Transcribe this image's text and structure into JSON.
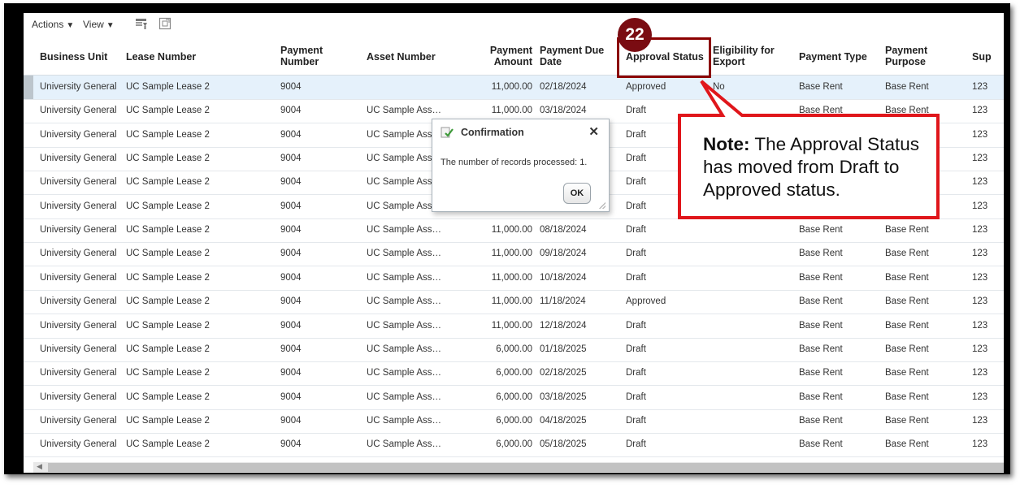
{
  "toolbar": {
    "actions_label": "Actions",
    "view_label": "View",
    "caret": "▼",
    "icons": [
      "freeze-icon",
      "detach-icon"
    ]
  },
  "columns": [
    "Business Unit",
    "Lease Number",
    "Payment Number",
    "Asset Number",
    "Payment Amount",
    "Payment Due Date",
    "Approval Status",
    "Eligibility for Export",
    "Payment Type",
    "Payment Purpose",
    "Sup"
  ],
  "column_header_lines": {
    "payment_number": [
      "Payment",
      "Number"
    ],
    "payment_amount": [
      "Payment",
      "Amount"
    ],
    "payment_due_date": [
      "Payment Due",
      "Date"
    ],
    "eligibility": [
      "Eligibility for",
      "Export"
    ],
    "payment_purpose": [
      "Payment",
      "Purpose"
    ]
  },
  "rows": [
    {
      "bu": "University General",
      "lease": "UC Sample Lease 2",
      "payno": "9004",
      "asset": "",
      "amount": "11,000.00",
      "due": "02/18/2024",
      "status": "Approved",
      "elig": "No",
      "ptype": "Base Rent",
      "purpose": "Base Rent",
      "sup": "123"
    },
    {
      "bu": "University General",
      "lease": "UC Sample Lease 2",
      "payno": "9004",
      "asset": "UC Sample Ass…",
      "amount": "11,000.00",
      "due": "03/18/2024",
      "status": "Draft",
      "elig": "",
      "ptype": "Base Rent",
      "purpose": "Base Rent",
      "sup": "123"
    },
    {
      "bu": "University General",
      "lease": "UC Sample Lease 2",
      "payno": "9004",
      "asset": "UC Sample Ass",
      "amount": "",
      "due": "",
      "status": "Draft",
      "elig": "",
      "ptype": "",
      "purpose": "",
      "sup": "123"
    },
    {
      "bu": "University General",
      "lease": "UC Sample Lease 2",
      "payno": "9004",
      "asset": "UC Sample Ass",
      "amount": "",
      "due": "",
      "status": "Draft",
      "elig": "",
      "ptype": "",
      "purpose": "",
      "sup": "123"
    },
    {
      "bu": "University General",
      "lease": "UC Sample Lease 2",
      "payno": "9004",
      "asset": "UC Sample Ass",
      "amount": "",
      "due": "",
      "status": "Draft",
      "elig": "",
      "ptype": "",
      "purpose": "",
      "sup": "123"
    },
    {
      "bu": "University General",
      "lease": "UC Sample Lease 2",
      "payno": "9004",
      "asset": "UC Sample Ass",
      "amount": "",
      "due": "",
      "status": "Draft",
      "elig": "",
      "ptype": "",
      "purpose": "",
      "sup": "123"
    },
    {
      "bu": "University General",
      "lease": "UC Sample Lease 2",
      "payno": "9004",
      "asset": "UC Sample Ass…",
      "amount": "11,000.00",
      "due": "08/18/2024",
      "status": "Draft",
      "elig": "",
      "ptype": "Base Rent",
      "purpose": "Base Rent",
      "sup": "123"
    },
    {
      "bu": "University General",
      "lease": "UC Sample Lease 2",
      "payno": "9004",
      "asset": "UC Sample Ass…",
      "amount": "11,000.00",
      "due": "09/18/2024",
      "status": "Draft",
      "elig": "",
      "ptype": "Base Rent",
      "purpose": "Base Rent",
      "sup": "123"
    },
    {
      "bu": "University General",
      "lease": "UC Sample Lease 2",
      "payno": "9004",
      "asset": "UC Sample Ass…",
      "amount": "11,000.00",
      "due": "10/18/2024",
      "status": "Draft",
      "elig": "",
      "ptype": "Base Rent",
      "purpose": "Base Rent",
      "sup": "123"
    },
    {
      "bu": "University General",
      "lease": "UC Sample Lease 2",
      "payno": "9004",
      "asset": "UC Sample Ass…",
      "amount": "11,000.00",
      "due": "11/18/2024",
      "status": "Approved",
      "elig": "",
      "ptype": "Base Rent",
      "purpose": "Base Rent",
      "sup": "123"
    },
    {
      "bu": "University General",
      "lease": "UC Sample Lease 2",
      "payno": "9004",
      "asset": "UC Sample Ass…",
      "amount": "11,000.00",
      "due": "12/18/2024",
      "status": "Draft",
      "elig": "",
      "ptype": "Base Rent",
      "purpose": "Base Rent",
      "sup": "123"
    },
    {
      "bu": "University General",
      "lease": "UC Sample Lease 2",
      "payno": "9004",
      "asset": "UC Sample Ass…",
      "amount": "6,000.00",
      "due": "01/18/2025",
      "status": "Draft",
      "elig": "",
      "ptype": "Base Rent",
      "purpose": "Base Rent",
      "sup": "123"
    },
    {
      "bu": "University General",
      "lease": "UC Sample Lease 2",
      "payno": "9004",
      "asset": "UC Sample Ass…",
      "amount": "6,000.00",
      "due": "02/18/2025",
      "status": "Draft",
      "elig": "",
      "ptype": "Base Rent",
      "purpose": "Base Rent",
      "sup": "123"
    },
    {
      "bu": "University General",
      "lease": "UC Sample Lease 2",
      "payno": "9004",
      "asset": "UC Sample Ass…",
      "amount": "6,000.00",
      "due": "03/18/2025",
      "status": "Draft",
      "elig": "",
      "ptype": "Base Rent",
      "purpose": "Base Rent",
      "sup": "123"
    },
    {
      "bu": "University General",
      "lease": "UC Sample Lease 2",
      "payno": "9004",
      "asset": "UC Sample Ass…",
      "amount": "6,000.00",
      "due": "04/18/2025",
      "status": "Draft",
      "elig": "",
      "ptype": "Base Rent",
      "purpose": "Base Rent",
      "sup": "123"
    },
    {
      "bu": "University General",
      "lease": "UC Sample Lease 2",
      "payno": "9004",
      "asset": "UC Sample Ass…",
      "amount": "6,000.00",
      "due": "05/18/2025",
      "status": "Draft",
      "elig": "",
      "ptype": "Base Rent",
      "purpose": "Base Rent",
      "sup": "123"
    }
  ],
  "dialog": {
    "title": "Confirmation",
    "message": "The number of records processed: 1.",
    "ok_label": "OK",
    "close_glyph": "✕"
  },
  "step_badge": "22",
  "callout": {
    "note_label": "Note:",
    "text": " The Approval Status has moved from Draft to Approved status."
  },
  "colors": {
    "highlight": "#8b0000",
    "badge": "#7a0c12",
    "callout_border": "#e0161b",
    "selected_row": "#e5f1fb"
  }
}
